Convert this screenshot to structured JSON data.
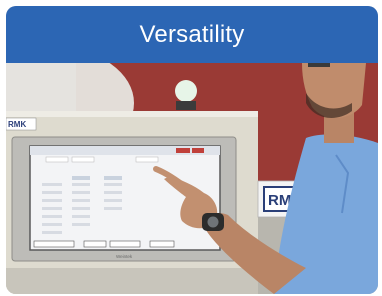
{
  "card": {
    "title": "Versatility"
  },
  "photo": {
    "subject": "operator-touching-hmi-touchscreen",
    "panel_logo_text": "RMK",
    "wall_logo_text": "RM",
    "panel_brand_text": "Weintek",
    "colors": {
      "header_bg": "#2c66b4",
      "wall_red": "#9a3a35",
      "shirt_blue": "#7aa7dc",
      "panel_beige": "#dedbcf"
    }
  }
}
